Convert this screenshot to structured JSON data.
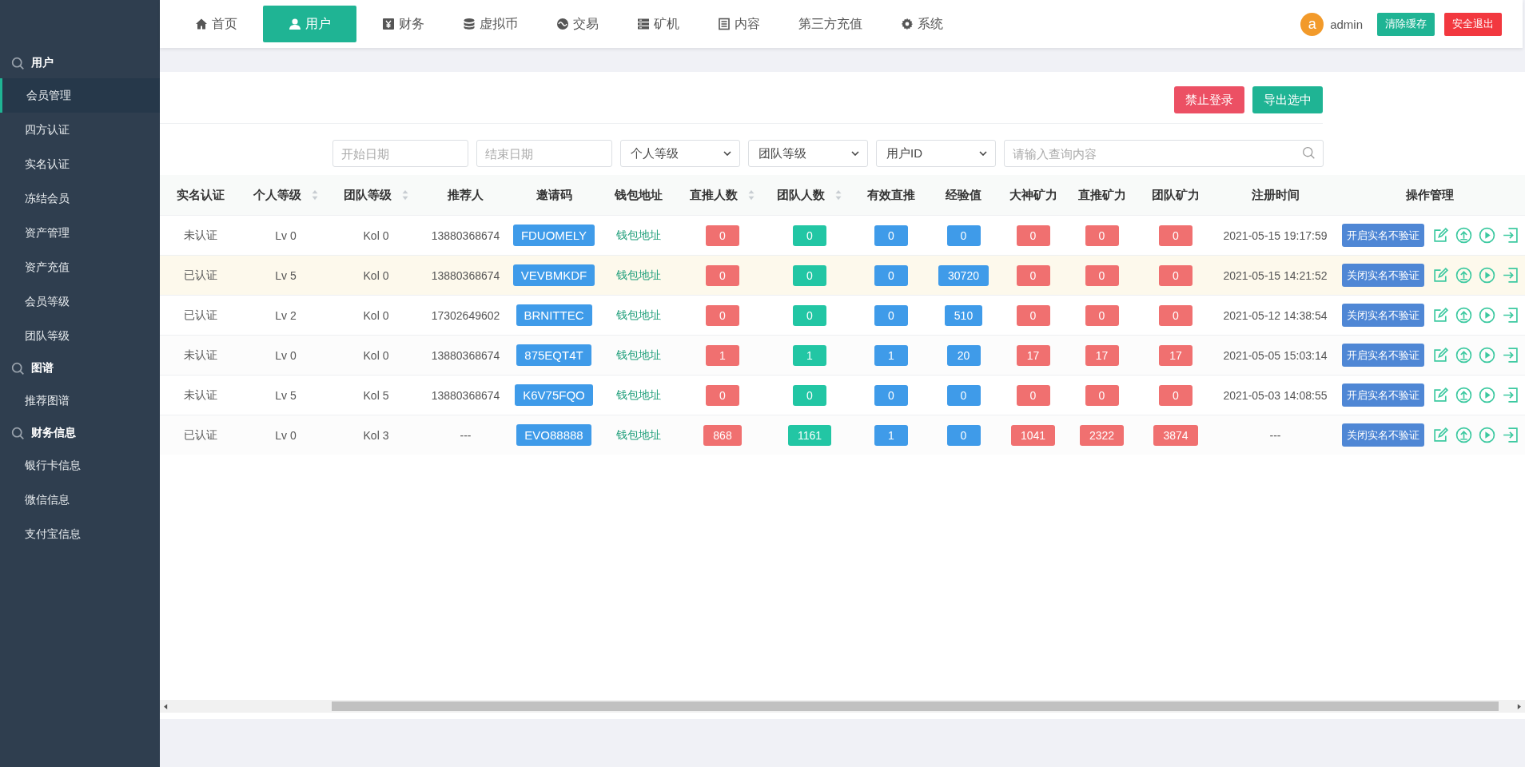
{
  "nav": {
    "items": [
      {
        "label": "首页",
        "selected": false
      },
      {
        "label": "用户",
        "selected": true
      },
      {
        "label": "财务",
        "selected": false
      },
      {
        "label": "虚拟币",
        "selected": false
      },
      {
        "label": "交易",
        "selected": false
      },
      {
        "label": "矿机",
        "selected": false
      },
      {
        "label": "内容",
        "selected": false
      },
      {
        "label": "第三方充值",
        "selected": false
      },
      {
        "label": "系统",
        "selected": false
      }
    ],
    "user": {
      "avatar": "a",
      "name": "admin"
    },
    "buttons": [
      {
        "label": "清除缓存",
        "kind": "primary"
      },
      {
        "label": "安全退出",
        "kind": "danger"
      }
    ]
  },
  "sidebar": {
    "groups": [
      {
        "title": "用户",
        "items": [
          {
            "label": "会员管理",
            "selected": true
          },
          {
            "label": "四方认证",
            "selected": false
          },
          {
            "label": "实名认证",
            "selected": false
          },
          {
            "label": "冻结会员",
            "selected": false
          },
          {
            "label": "资产管理",
            "selected": false
          },
          {
            "label": "资产充值",
            "selected": false
          },
          {
            "label": "会员等级",
            "selected": false
          },
          {
            "label": "团队等级",
            "selected": false
          }
        ]
      },
      {
        "title": "图谱",
        "items": [
          {
            "label": "推荐图谱",
            "selected": false
          }
        ]
      },
      {
        "title": "财务信息",
        "items": [
          {
            "label": "银行卡信息",
            "selected": false
          },
          {
            "label": "微信信息",
            "selected": false
          },
          {
            "label": "支付宝信息",
            "selected": false
          }
        ]
      }
    ]
  },
  "toolbar": {
    "buttons": [
      {
        "label": "禁止登录",
        "kind": "danger"
      },
      {
        "label": "导出选中",
        "kind": "primary"
      }
    ]
  },
  "filters": [
    {
      "kind": "input",
      "placeholder": "开始日期"
    },
    {
      "kind": "input",
      "placeholder": "结束日期"
    },
    {
      "kind": "select",
      "value": "个人等级"
    },
    {
      "kind": "select",
      "value": "团队等级"
    },
    {
      "kind": "select",
      "value": "用户ID"
    },
    {
      "kind": "search",
      "placeholder": "请输入查询内容"
    }
  ],
  "table": {
    "columns": [
      {
        "label": "实名认证",
        "kind": "text",
        "sortable": false
      },
      {
        "label": "个人等级",
        "kind": "text",
        "sortable": true
      },
      {
        "label": "团队等级",
        "kind": "text",
        "sortable": true
      },
      {
        "label": "推荐人",
        "kind": "text",
        "sortable": false
      },
      {
        "label": "邀请码",
        "kind": "code",
        "sortable": false
      },
      {
        "label": "钱包地址",
        "kind": "link",
        "sortable": false
      },
      {
        "label": "直推人数",
        "kind": "tag",
        "color": "#f07070",
        "sortable": true
      },
      {
        "label": "团队人数",
        "kind": "tag",
        "color": "#22c6a4",
        "sortable": true
      },
      {
        "label": "有效直推",
        "kind": "tag",
        "color": "#3f9be9",
        "sortable": false
      },
      {
        "label": "经验值",
        "kind": "tag",
        "color": "#3f9be9",
        "sortable": false
      },
      {
        "label": "大神矿力",
        "kind": "tag",
        "color": "#f07070",
        "sortable": false
      },
      {
        "label": "直推矿力",
        "kind": "tag",
        "color": "#f07070",
        "sortable": false
      },
      {
        "label": "团队矿力",
        "kind": "tag",
        "color": "#f07070",
        "sortable": false
      },
      {
        "label": "注册时间",
        "kind": "text",
        "sortable": false
      },
      {
        "label": "操作管理",
        "kind": "actions",
        "sortable": false
      }
    ],
    "rows": [
      {
        "selected": false,
        "cells": [
          "未认证",
          "Lv 0",
          "Kol 0",
          "13880368674",
          "FDUOMELY",
          "钱包地址",
          "0",
          "0",
          "0",
          "0",
          "0",
          "0",
          "0",
          "2021-05-15 19:17:59",
          "开启实名不验证"
        ]
      },
      {
        "selected": true,
        "cells": [
          "已认证",
          "Lv 5",
          "Kol 0",
          "13880368674",
          "VEVBMKDF",
          "钱包地址",
          "0",
          "0",
          "0",
          "30720",
          "0",
          "0",
          "0",
          "2021-05-15 14:21:52",
          "关闭实名不验证"
        ]
      },
      {
        "selected": false,
        "cells": [
          "已认证",
          "Lv 2",
          "Kol 0",
          "17302649602",
          "BRNITTEC",
          "钱包地址",
          "0",
          "0",
          "0",
          "510",
          "0",
          "0",
          "0",
          "2021-05-12 14:38:54",
          "关闭实名不验证"
        ]
      },
      {
        "selected": false,
        "cells": [
          "未认证",
          "Lv 0",
          "Kol 0",
          "13880368674",
          "875EQT4T",
          "钱包地址",
          "1",
          "1",
          "1",
          "20",
          "17",
          "17",
          "17",
          "2021-05-05 15:03:14",
          "开启实名不验证"
        ]
      },
      {
        "selected": false,
        "cells": [
          "未认证",
          "Lv 5",
          "Kol 5",
          "13880368674",
          "K6V75FQO",
          "钱包地址",
          "0",
          "0",
          "0",
          "0",
          "0",
          "0",
          "0",
          "2021-05-03 14:08:55",
          "开启实名不验证"
        ]
      },
      {
        "selected": false,
        "cells": [
          "已认证",
          "Lv 0",
          "Kol 3",
          "---",
          "EVO88888",
          "钱包地址",
          "868",
          "1161",
          "1",
          "0",
          "1041",
          "2322",
          "3874",
          "---",
          "关闭实名不验证"
        ]
      }
    ]
  }
}
